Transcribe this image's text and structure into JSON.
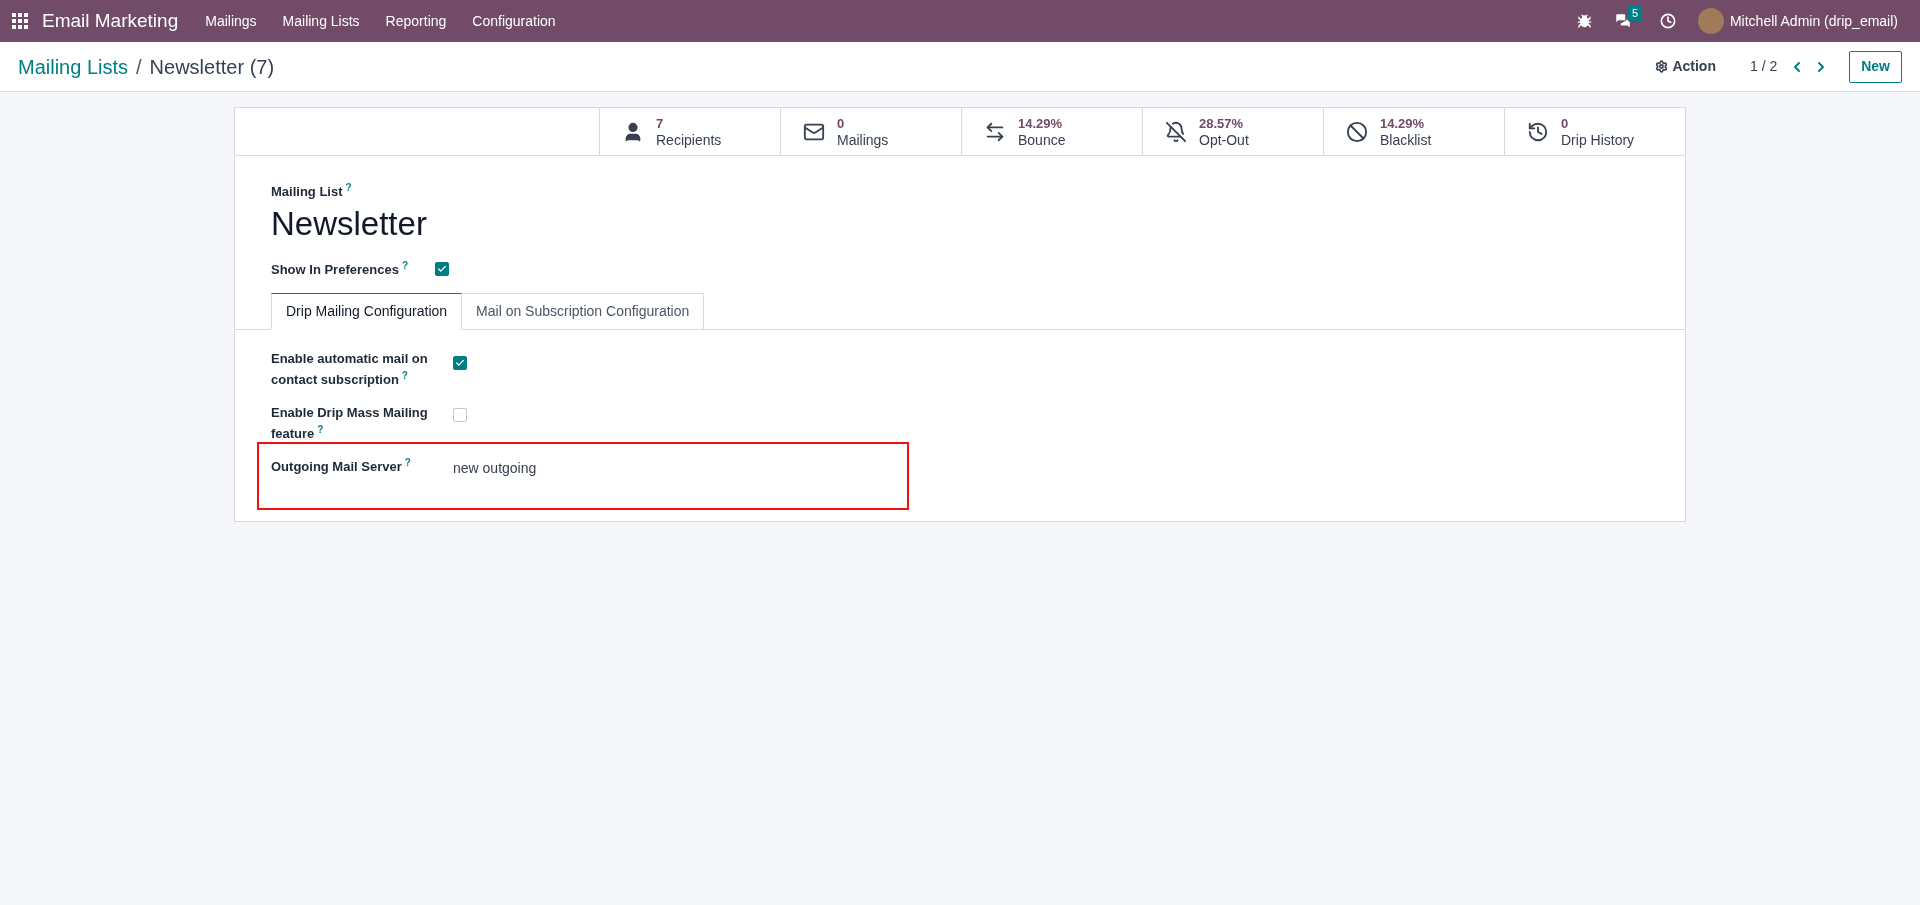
{
  "navbar": {
    "app_name": "Email Marketing",
    "menu": [
      "Mailings",
      "Mailing Lists",
      "Reporting",
      "Configuration"
    ],
    "messages_badge": "5",
    "user": "Mitchell Admin (drip_email)"
  },
  "control_panel": {
    "breadcrumb": [
      "Mailing Lists",
      "Newsletter (7)"
    ],
    "breadcrumb_separator": "/",
    "action": "Action",
    "pager": "1 / 2",
    "new_button": "New"
  },
  "stat_buttons": [
    {
      "kind": "recipients",
      "value": "7",
      "label": "Recipients"
    },
    {
      "kind": "mailings",
      "value": "0",
      "label": "Mailings"
    },
    {
      "kind": "bounce",
      "value": "14.29%",
      "label": "Bounce"
    },
    {
      "kind": "optout",
      "value": "28.57%",
      "label": "Opt-Out"
    },
    {
      "kind": "blacklist",
      "value": "14.29%",
      "label": "Blacklist"
    },
    {
      "kind": "history",
      "value": "0",
      "label": "Drip History"
    }
  ],
  "form": {
    "name_label": "Mailing List",
    "name_help": "?",
    "name": "Newsletter",
    "show_in_preferences": {
      "label": "Show In Preferences",
      "help": "?",
      "checked": true
    },
    "tabs": [
      {
        "label": "Drip Mailing Configuration",
        "selected": true
      },
      {
        "label": "Mail on Subscription Configuration",
        "selected": false
      }
    ],
    "fields": [
      {
        "kind": "checkbox",
        "label": "Enable automatic mail on contact subscription",
        "help": "?",
        "checked": true,
        "highlighted": false
      },
      {
        "kind": "checkbox",
        "label": "Enable Drip Mass Mailing feature",
        "help": "?",
        "checked": false,
        "highlighted": false
      },
      {
        "kind": "text",
        "label": "Outgoing Mail Server",
        "help": "?",
        "value": "new outgoing",
        "highlighted": true
      }
    ]
  }
}
